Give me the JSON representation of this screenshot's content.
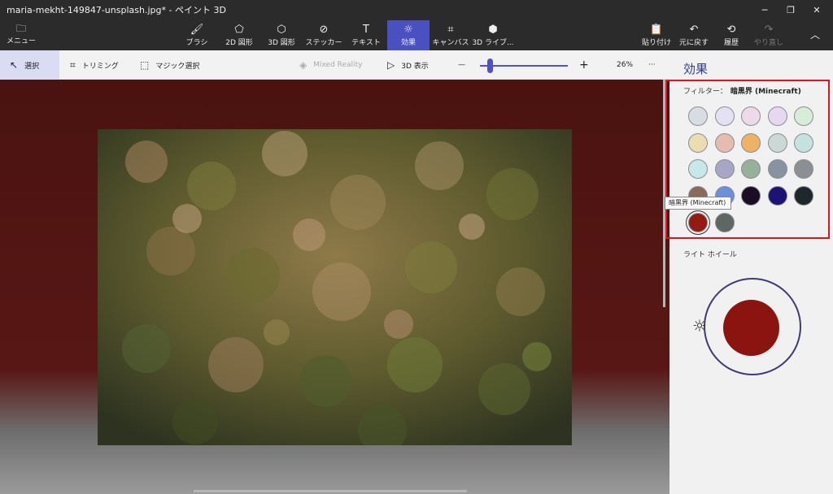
{
  "window": {
    "title": "maria-mekht-149847-unsplash.jpg* - ペイント 3D",
    "controls": [
      "minimize",
      "restore",
      "close"
    ]
  },
  "menu": {
    "label": "メニュー",
    "icon": "folder-icon"
  },
  "tools": [
    {
      "label": "ブラシ",
      "icon": "brush-icon",
      "active": false
    },
    {
      "label": "2D 図形",
      "icon": "2d-shapes-icon",
      "active": false
    },
    {
      "label": "3D 図形",
      "icon": "3d-shapes-icon",
      "active": false
    },
    {
      "label": "ステッカー",
      "icon": "sticker-icon",
      "active": false
    },
    {
      "label": "テキスト",
      "icon": "text-icon",
      "active": false
    },
    {
      "label": "効果",
      "icon": "effects-icon",
      "active": true
    },
    {
      "label": "キャンバス",
      "icon": "canvas-icon",
      "active": false
    },
    {
      "label": "3D ライブ...",
      "icon": "3d-library-icon",
      "active": false
    }
  ],
  "actions": [
    {
      "label": "貼り付け",
      "icon": "paste-icon",
      "enabled": true
    },
    {
      "label": "元に戻す",
      "icon": "undo-icon",
      "enabled": true
    },
    {
      "label": "履歴",
      "icon": "history-icon",
      "enabled": true
    },
    {
      "label": "やり直し",
      "icon": "redo-icon",
      "enabled": false
    }
  ],
  "toolbar": {
    "select": "選択",
    "crop": "トリミング",
    "magic_select": "マジック選択",
    "mixed_reality": "Mixed Reality",
    "view3d": "3D 表示",
    "zoom_out": "—",
    "zoom_in": "+",
    "zoom": "26%",
    "more": "···"
  },
  "panel": {
    "title": "効果",
    "filter_label": "フィルター：",
    "filter_value": "暗黒界 (Minecraft)",
    "tooltip": "暗黒界 (Minecraft)",
    "light_wheel_label": "ライト ホイール",
    "light_color": "#8c1410",
    "swatches": [
      "#d7dde3",
      "#e4e2f2",
      "#eed9e8",
      "#e6d9ef",
      "#d6edd7",
      "#ecdcb2",
      "#e5bcae",
      "#ebb268",
      "#ccd8d4",
      "#c6e2de",
      "#c9e6e9",
      "#a7a6c4",
      "#98b09a",
      "#8892a0",
      "#8b8f93",
      "#8a6a5c",
      "#6c8fdb",
      "#1b0d24",
      "#1c1374",
      "#1e2729",
      "#951a12",
      "#5e6761"
    ],
    "selected_swatch": 20
  }
}
